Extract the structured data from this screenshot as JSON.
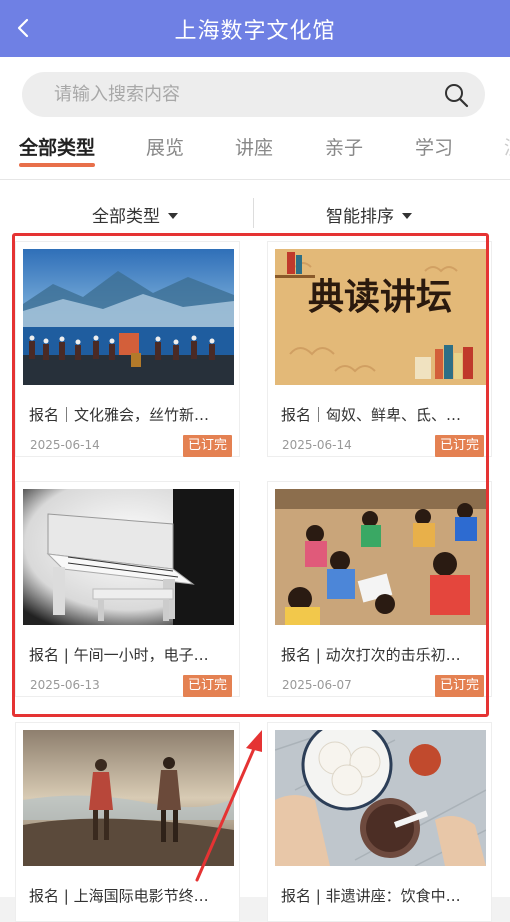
{
  "header": {
    "title": "上海数字文化馆",
    "back_icon": "chevron-left-icon"
  },
  "search": {
    "placeholder": "请输入搜索内容",
    "value": "",
    "icon": "search-icon"
  },
  "tabs": [
    {
      "label": "全部类型",
      "active": true
    },
    {
      "label": "展览",
      "active": false
    },
    {
      "label": "讲座",
      "active": false
    },
    {
      "label": "亲子",
      "active": false
    },
    {
      "label": "学习",
      "active": false
    },
    {
      "label": "演",
      "active": false
    }
  ],
  "filters": {
    "type_label": "全部类型",
    "sort_label": "智能排序"
  },
  "cards": [
    {
      "title": "报名｜文化雅会，丝竹新…",
      "date": "2025-06-14",
      "badge": "已订完",
      "image": "orchestra-on-lake"
    },
    {
      "title": "报名｜匈奴、鲜卑、氐、…",
      "date": "2025-06-14",
      "badge": "已订完",
      "image": "dian-du-jiang-tan-poster",
      "poster_text": "典读讲坛"
    },
    {
      "title": "报名 | 午间一小时，电子…",
      "date": "2025-06-13",
      "badge": "已订完",
      "image": "electronic-organ"
    },
    {
      "title": "报名 | 动次打次的击乐初…",
      "date": "2025-06-07",
      "badge": "已订完",
      "image": "children-playing"
    },
    {
      "title": "报名 | 上海国际电影节终…",
      "date": "",
      "badge": "",
      "image": "couple-on-beach"
    },
    {
      "title": "报名 | 非遗讲座：饮食中…",
      "date": "",
      "badge": "",
      "image": "steamed-buns"
    }
  ],
  "colors": {
    "header": "#6f80e4",
    "accent": "#e86f4a",
    "badge": "#e48152",
    "highlight_box": "#e53333"
  }
}
